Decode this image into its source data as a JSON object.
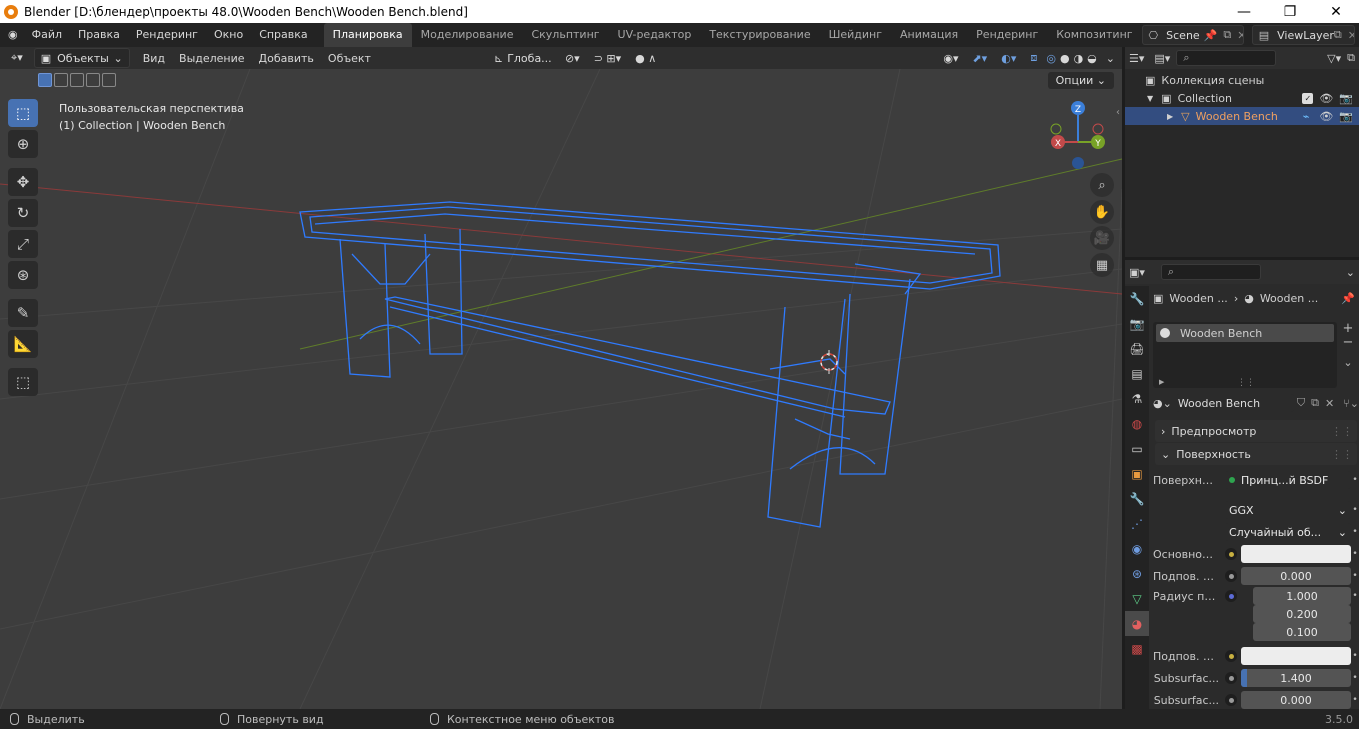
{
  "window": {
    "title": "Blender [D:\\блендер\\проекты 48.0\\Wooden Bench\\Wooden Bench.blend]",
    "minimize": "—",
    "maximize": "❐",
    "close": "✕"
  },
  "menu": [
    "Файл",
    "Правка",
    "Рендеринг",
    "Окно",
    "Справка"
  ],
  "workspaces": [
    "Планировка",
    "Моделирование",
    "Скульптинг",
    "UV-редактор",
    "Текстурирование",
    "Шейдинг",
    "Анимация",
    "Рендеринг",
    "Композитинг"
  ],
  "active_workspace": "Планировка",
  "scene": {
    "name": "Scene",
    "view_layer": "ViewLayer"
  },
  "view_header": {
    "mode": "Объекты",
    "menus": [
      "Вид",
      "Выделение",
      "Добавить",
      "Объект"
    ],
    "orientation": "Глоба..."
  },
  "viewport": {
    "perspective": "Пользовательская перспектива",
    "collection_info": "(1) Collection | Wooden Bench",
    "options": "Опции",
    "axis_x": "X",
    "axis_y": "Y",
    "axis_z": "Z",
    "wire_color": "#2f7bff",
    "grid_x_color": "#8b3a3a",
    "grid_y_color": "#6a8a2a"
  },
  "outliner": {
    "rows": [
      {
        "label": "Коллекция сцены"
      },
      {
        "label": "Collection"
      },
      {
        "label": "Wooden Bench"
      }
    ]
  },
  "properties": {
    "breadcrumb": [
      "Wooden ...",
      "Wooden ..."
    ],
    "material_slot": "Wooden Bench",
    "material_name": "Wooden Bench",
    "preview_label": "Предпросмотр",
    "surface_label": "Поверхность",
    "rows": [
      {
        "label": "Поверхность",
        "value": "Принц...й BSDF",
        "dot": "#2ea44f"
      },
      {
        "label": "",
        "value": "GGX",
        "dot": ""
      },
      {
        "label": "",
        "value": "Случайный об...",
        "dot": ""
      },
      {
        "label": "Основной ...",
        "value": "",
        "dot": "#c8b040",
        "swatch": "#ededed"
      },
      {
        "label": "Подпов. р...",
        "value": "0.000",
        "dot": "#9a9a9a"
      },
      {
        "label": "Радиус по...",
        "value": "1.000",
        "dot": "#5c6bd6"
      },
      {
        "label": "",
        "value": "0.200",
        "dot": ""
      },
      {
        "label": "",
        "value": "0.100",
        "dot": ""
      },
      {
        "label": "Подпов. цв...",
        "value": "",
        "dot": "#c8b040",
        "swatch": "#ededed"
      },
      {
        "label": "Subsurfac...",
        "value": "1.400",
        "dot": "#9a9a9a",
        "bar": true
      },
      {
        "label": "Subsurfac...",
        "value": "0.000",
        "dot": "#9a9a9a"
      }
    ]
  },
  "status": {
    "select": "Выделить",
    "rotate": "Повернуть вид",
    "context": "Контекстное меню объектов",
    "version": "3.5.0"
  }
}
